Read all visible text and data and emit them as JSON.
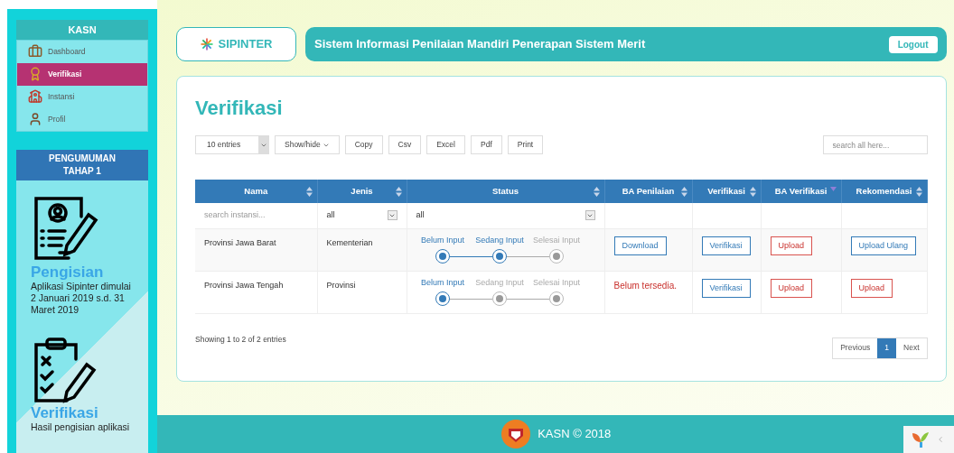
{
  "sidebar": {
    "title": "KASN",
    "items": [
      {
        "label": "Dashboard",
        "selected": false
      },
      {
        "label": "Verifikasi",
        "selected": true
      },
      {
        "label": "Instansi",
        "selected": false
      },
      {
        "label": "Profil",
        "selected": false
      }
    ],
    "announcement": {
      "title": "PENGUMUMAN TAHAP 1",
      "blocks": [
        {
          "heading": "Pengisian",
          "text": "Aplikasi Sipinter dimulai 2 Januari 2019 s.d. 31 Maret 2019"
        },
        {
          "heading": "Verifikasi",
          "text": "Hasil pengisian aplikasi"
        }
      ]
    }
  },
  "header": {
    "logo": "SIPINTER",
    "title": "Sistem Informasi Penilaian Mandiri Penerapan Sistem Merit",
    "logout": "Logout"
  },
  "page_title": "Verifikasi",
  "toolbar": {
    "length": "10 entries",
    "showhide": "Show/hide",
    "buttons": [
      "Copy",
      "Csv",
      "Excel",
      "Pdf",
      "Print"
    ],
    "search": {
      "placeholder": "search all here..."
    }
  },
  "table": {
    "columns": [
      {
        "label": "Nama",
        "sorted": false
      },
      {
        "label": "Jenis",
        "sorted": false
      },
      {
        "label": "Status",
        "sorted": false
      },
      {
        "label": "BA Penilaian",
        "sorted": false
      },
      {
        "label": "Verifikasi",
        "sorted": false
      },
      {
        "label": "BA Verifikasi",
        "sorted": true
      },
      {
        "label": "Rekomendasi",
        "sorted": false
      }
    ],
    "filters": {
      "nama": {
        "placeholder": "search instansi..."
      },
      "jenis": "all",
      "status": "all"
    },
    "rows": [
      {
        "nama": "Provinsi Jawa Barat",
        "jenis": "Kementerian",
        "steps": [
          {
            "label": "Belum Input",
            "done": true
          },
          {
            "label": "Sedang Input",
            "done": true
          },
          {
            "label": "Selesai Input",
            "done": false
          }
        ],
        "actions": [
          {
            "kind": "primary",
            "label": "Download"
          },
          {
            "kind": "primary",
            "label": "Verifikasi"
          },
          {
            "kind": "danger",
            "label": "Upload"
          },
          {
            "kind": "primary",
            "label": "Upload Ulang"
          }
        ]
      },
      {
        "nama": "Provinsi Jawa Tengah",
        "jenis": "Provinsi",
        "steps": [
          {
            "label": "Belum Input",
            "done": true
          },
          {
            "label": "Sedang Input",
            "done": false
          },
          {
            "label": "Selesai Input",
            "done": false
          }
        ],
        "actions": [
          {
            "kind": "text",
            "label": "Belum tersedia."
          },
          {
            "kind": "primary",
            "label": "Verifikasi"
          },
          {
            "kind": "danger",
            "label": "Upload"
          },
          {
            "kind": "danger",
            "label": "Upload"
          }
        ]
      }
    ]
  },
  "info": "Showing 1 to 2 of 2 entries",
  "pagination": [
    {
      "label": "Previous",
      "selected": false
    },
    {
      "label": "1",
      "selected": true
    },
    {
      "label": "Next",
      "selected": false
    }
  ],
  "footer": "KASN © 2018"
}
